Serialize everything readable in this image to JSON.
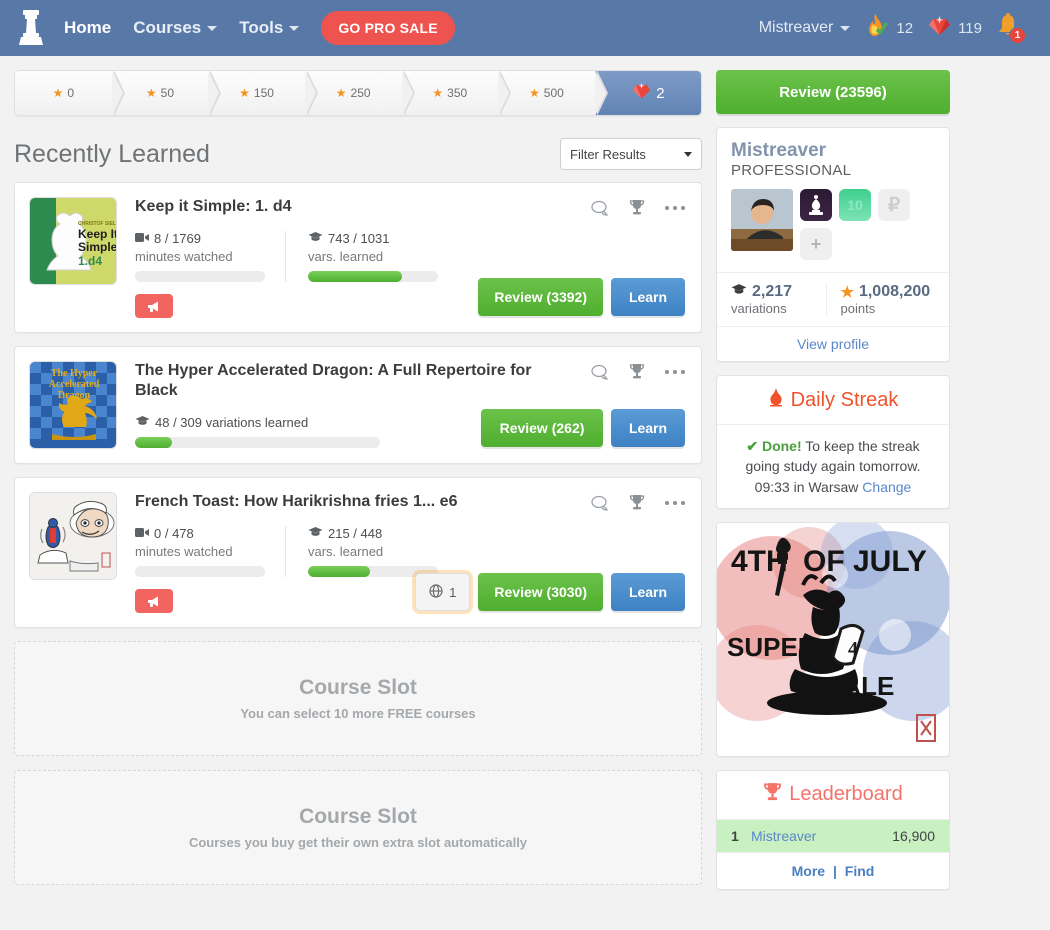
{
  "nav": {
    "logo_icon": "chess-rook-icon",
    "links": [
      {
        "label": "Home",
        "has_caret": false
      },
      {
        "label": "Courses",
        "has_caret": true
      },
      {
        "label": "Tools",
        "has_caret": true
      }
    ],
    "gopro_label": "GO PRO SALE",
    "username": "Mistreaver",
    "streak_icon": "flame-check-icon",
    "streak_count": "12",
    "gem_icon": "ruby-gem-icon",
    "gem_count": "119",
    "bell_icon": "bell-icon",
    "bell_badge": "1"
  },
  "progress": {
    "steps": [
      "0",
      "50",
      "150",
      "250",
      "350",
      "500"
    ],
    "current_icon": "ruby-gem-icon",
    "current_value": "2"
  },
  "section": {
    "title": "Recently Learned",
    "filter_label": "Filter Results"
  },
  "courses": [
    {
      "title": "Keep it Simple: 1. d4",
      "thumb": "keep-it-simple-1d4",
      "thumb_lines": [
        "Keep It",
        "Simple",
        "1.d4"
      ],
      "thumb_author": "CHRISTOF SIELECKI",
      "metrics": [
        {
          "icon": "video-icon",
          "value": "8 / 1769",
          "label": "minutes watched",
          "percent": 0
        },
        {
          "icon": "graduation-cap-icon",
          "value": "743 / 1031",
          "label": "vars. learned",
          "percent": 72
        }
      ],
      "single_metric": false,
      "megaphone": true,
      "globe_badge": null,
      "review_label": "Review (3392)",
      "learn_label": "Learn"
    },
    {
      "title": "The Hyper Accelerated Dragon: A Full Repertoire for Black",
      "thumb": "hyper-accelerated-dragon",
      "thumb_lines": [
        "The Hyper",
        "Accelerated",
        "Dragon"
      ],
      "thumb_author": "",
      "metrics": [
        {
          "icon": "graduation-cap-icon",
          "value": "48 / 309 variations learned",
          "label": "",
          "percent": 15
        }
      ],
      "single_metric": true,
      "megaphone": false,
      "globe_badge": null,
      "review_label": "Review (262)",
      "learn_label": "Learn"
    },
    {
      "title": "French Toast: How Harikrishna fries 1... e6",
      "thumb": "french-toast",
      "thumb_lines": [],
      "thumb_author": "",
      "metrics": [
        {
          "icon": "video-icon",
          "value": "0 / 478",
          "label": "minutes watched",
          "percent": 0
        },
        {
          "icon": "graduation-cap-icon",
          "value": "215 / 448",
          "label": "vars. learned",
          "percent": 48
        }
      ],
      "single_metric": false,
      "megaphone": true,
      "globe_badge": "1",
      "review_label": "Review (3030)",
      "learn_label": "Learn"
    }
  ],
  "card_icons": {
    "comment": "comment-bubble-icon",
    "trophy": "trophy-icon",
    "more": "more-options-icon"
  },
  "slots": [
    {
      "title": "Course Slot",
      "subtitle": "You can select 10 more FREE courses"
    },
    {
      "title": "Course Slot",
      "subtitle": "Courses you buy get their own extra slot automatically"
    }
  ],
  "sidebar": {
    "review_label": "Review (23596)",
    "profile": {
      "name": "Mistreaver",
      "role": "PROFESSIONAL",
      "avatar_icon": "user-photo",
      "badges": [
        {
          "kind": "dark",
          "text": "",
          "icon": "chess-bishop-badge-icon"
        },
        {
          "kind": "green",
          "text": "10",
          "icon": "level-10-badge-icon"
        },
        {
          "kind": "gray",
          "text": "₽",
          "icon": "ruble-badge-icon"
        },
        {
          "kind": "plus",
          "text": "+",
          "icon": "add-badge-icon"
        }
      ],
      "stats": [
        {
          "icon": "graduation-cap-icon",
          "value": "2,217",
          "label": "variations"
        },
        {
          "icon": "star-icon",
          "value": "1,008,200",
          "label": "points"
        }
      ],
      "view_profile": "View profile"
    },
    "streak": {
      "icon": "flame-icon",
      "title": "Daily Streak",
      "check": "✔",
      "done_label": "Done!",
      "body": "To keep the streak going study again tomorrow.",
      "time": "09:33 in Warsaw",
      "change_label": "Change"
    },
    "promo": {
      "alt": "4th-of-July-super-sale-banner",
      "line1": "4TH",
      "line2": "OF JULY",
      "line3": "SUPER",
      "line4": "SALE"
    },
    "leaderboard": {
      "icon": "trophy-icon",
      "title": "Leaderboard",
      "rows": [
        {
          "rank": "1",
          "name": "Mistreaver",
          "score": "16,900"
        }
      ],
      "more_label": "More",
      "separator": "|",
      "find_label": "Find"
    }
  },
  "colors": {
    "nav_bg": "#5878a8",
    "accent_red": "#ef5350",
    "green": "#4fae2f",
    "blue": "#3e82c4",
    "star_orange": "#f59221",
    "streak_orange": "#f0522a"
  }
}
